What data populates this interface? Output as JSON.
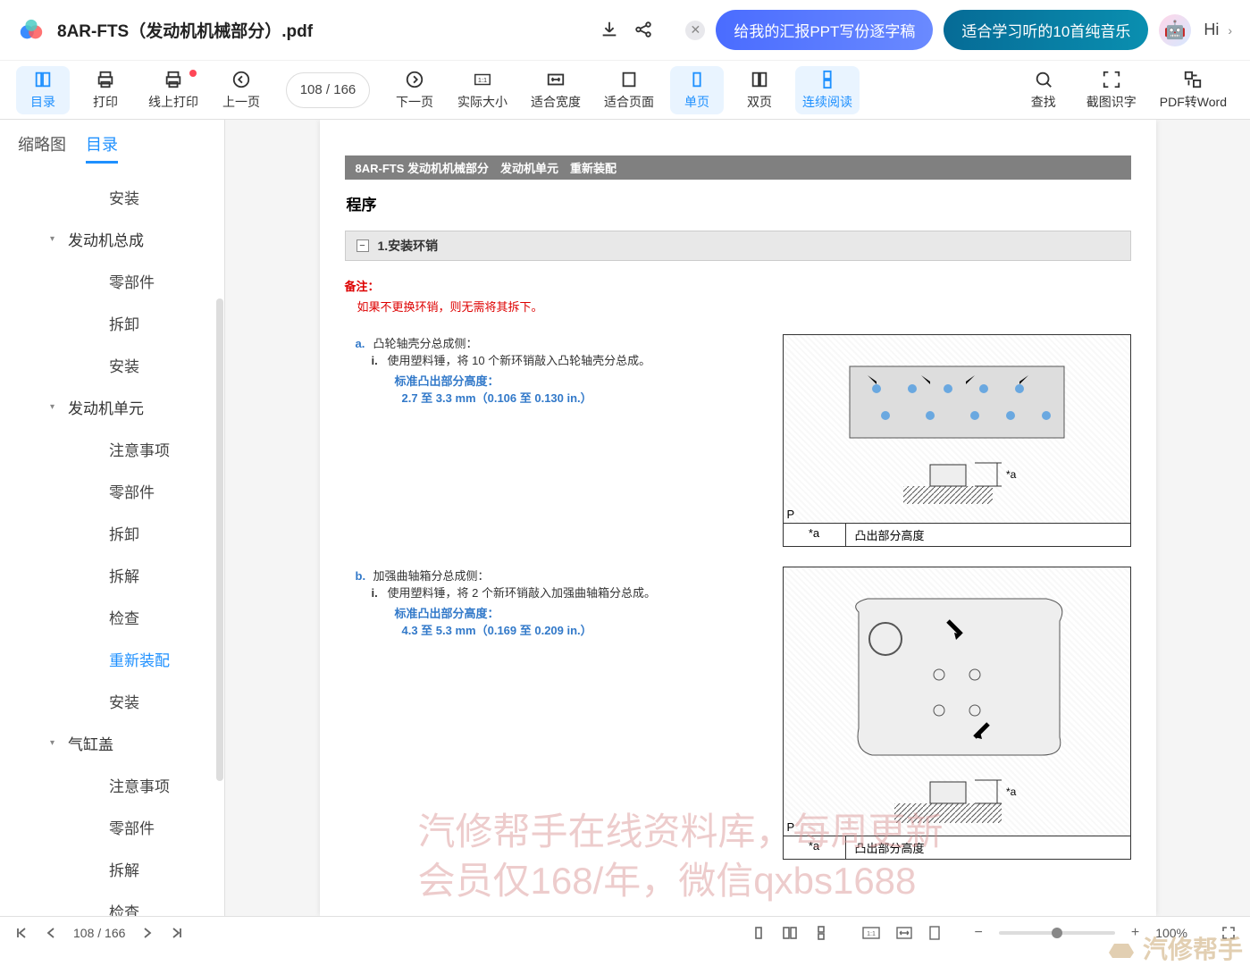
{
  "header": {
    "file_title": "8AR-FTS（发动机机械部分）.pdf",
    "promo": {
      "btn1": "给我的汇报PPT写份逐字稿",
      "btn2": "适合学习听的10首纯音乐"
    },
    "hi": "Hi"
  },
  "toolbar": {
    "toc": "目录",
    "print": "打印",
    "online_print": "线上打印",
    "prev": "上一页",
    "page_input": "108 / 166",
    "next": "下一页",
    "actual_size": "实际大小",
    "fit_width": "适合宽度",
    "fit_page": "适合页面",
    "single": "单页",
    "double": "双页",
    "continuous": "连续阅读",
    "find": "查找",
    "ocr": "截图识字",
    "pdf2word": "PDF转Word"
  },
  "sidebar": {
    "tabs": {
      "thumbnails": "缩略图",
      "toc": "目录"
    },
    "items": [
      {
        "level": "level-3",
        "label": "安装"
      },
      {
        "level": "group",
        "label": "发动机总成",
        "group": true
      },
      {
        "level": "level-3",
        "label": "零部件"
      },
      {
        "level": "level-3",
        "label": "拆卸"
      },
      {
        "level": "level-3",
        "label": "安装"
      },
      {
        "level": "group",
        "label": "发动机单元",
        "group": true
      },
      {
        "level": "level-3",
        "label": "注意事项"
      },
      {
        "level": "level-3",
        "label": "零部件"
      },
      {
        "level": "level-3",
        "label": "拆卸"
      },
      {
        "level": "level-3",
        "label": "拆解"
      },
      {
        "level": "level-3",
        "label": "检查"
      },
      {
        "level": "level-3",
        "label": "重新装配",
        "active": true
      },
      {
        "level": "level-3",
        "label": "安装"
      },
      {
        "level": "group",
        "label": "气缸盖",
        "group": true
      },
      {
        "level": "level-3",
        "label": "注意事项"
      },
      {
        "level": "level-3",
        "label": "零部件"
      },
      {
        "level": "level-3",
        "label": "拆解"
      },
      {
        "level": "level-3",
        "label": "检查"
      }
    ]
  },
  "doc": {
    "banner": "8AR-FTS 发动机机械部分　发动机单元　重新装配",
    "procedure": "程序",
    "step1": {
      "title": "1.安装环销",
      "note_label": "备注：",
      "note_text": "如果不更换环销，则无需将其拆下。",
      "a": {
        "letter": "a.",
        "title": "凸轮轴壳分总成侧：",
        "i_roman": "i.",
        "i_text": "使用塑料锤，将 10 个新环销敲入凸轮轴壳分总成。",
        "spec_label": "标准凸出部分高度：",
        "spec_value": "2.7 至 3.3 mm（0.106 至 0.130 in.）",
        "legend_key": "*a",
        "legend_val": "凸出部分高度",
        "p_tag": "P"
      },
      "b": {
        "letter": "b.",
        "title": "加强曲轴箱分总成侧：",
        "i_roman": "i.",
        "i_text": "使用塑料锤，将 2 个新环销敲入加强曲轴箱分总成。",
        "spec_label": "标准凸出部分高度：",
        "spec_value": "4.3 至 5.3 mm（0.169 至 0.209 in.）",
        "legend_key": "*a",
        "legend_val": "凸出部分高度",
        "p_tag": "P"
      }
    },
    "watermark_line1": "汽修帮手在线资料库，每周更新",
    "watermark_line2": "会员仅168/年，微信qxbs1688",
    "brand_wm": "汽修帮手"
  },
  "statusbar": {
    "page": "108 / 166",
    "zoom": "100%"
  }
}
